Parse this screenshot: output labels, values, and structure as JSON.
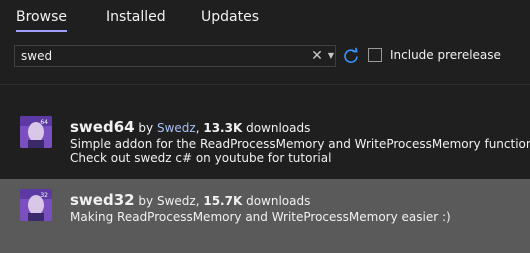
{
  "tabs": [
    {
      "label": "Browse",
      "active": true
    },
    {
      "label": "Installed",
      "active": false
    },
    {
      "label": "Updates",
      "active": false
    }
  ],
  "search": {
    "value": "swed",
    "placeholder": "",
    "clear_icon": "close-icon",
    "dropdown_icon": "chevron-down-icon"
  },
  "refresh_icon": "refresh-icon",
  "prerelease": {
    "label": "Include prerelease",
    "checked": false
  },
  "packages": [
    {
      "name": "swed64",
      "by": "by",
      "author": "Swedz",
      "downloads_num": "13.3K",
      "downloads_word": "downloads",
      "desc_line1": "Simple addon for the ReadProcessMemory and WriteProcessMemory functions :)",
      "desc_line2": "Check out swedz c# on youtube for tutorial",
      "icon_badge": "64",
      "selected": false
    },
    {
      "name": "swed32",
      "by": "by",
      "author": "Swedz",
      "downloads_num": "15.7K",
      "downloads_word": "downloads",
      "desc_line1": "Making ReadProcessMemory and WriteProcessMemory easier :)",
      "icon_badge": "32",
      "selected": true
    }
  ],
  "colors": {
    "background": "#1f1f1f",
    "selected_row": "#5a5a5a",
    "accent_underline": "#9ea0fb",
    "link": "#a7c1f5",
    "refresh": "#3794ff"
  }
}
